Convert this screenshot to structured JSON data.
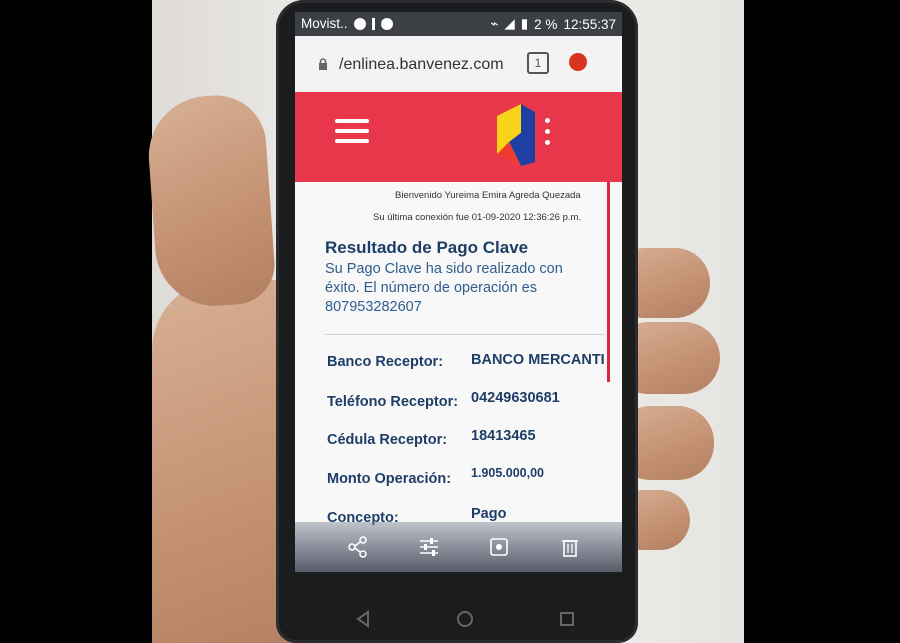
{
  "status_bar": {
    "carrier": "Movist..",
    "battery": "2 %",
    "time": "12:55:37"
  },
  "browser": {
    "url": "/enlinea.banvenez.com",
    "tab_count": "1"
  },
  "page": {
    "welcome": "Bienvenido Yureima Emira  Agreda Quezada",
    "last_connection": "Su última conexión fue 01-09-2020 12:36:26 p.m.",
    "result_title": "Resultado de Pago Clave",
    "result_message": "Su Pago Clave ha sido realizado con éxito. El número de operación es 807953282607",
    "rows": [
      {
        "label": "Banco Receptor:",
        "value": "BANCO MERCANTI"
      },
      {
        "label": "Teléfono Receptor:",
        "value": "04249630681"
      },
      {
        "label": "Cédula Receptor:",
        "value": "18413465"
      },
      {
        "label": "Monto Operación:",
        "value": "1.905.000,00"
      },
      {
        "label": "Concepto:",
        "value": "Pago"
      }
    ]
  },
  "colors": {
    "bank_red": "#e8374a",
    "text_blue": "#1e3e67",
    "msg_blue": "#2f5d8e"
  },
  "icons": {
    "toolbar": [
      "share-icon",
      "sliders-icon",
      "crop-icon",
      "trash-icon"
    ],
    "nav": [
      "back-icon",
      "home-icon",
      "recents-icon"
    ]
  }
}
